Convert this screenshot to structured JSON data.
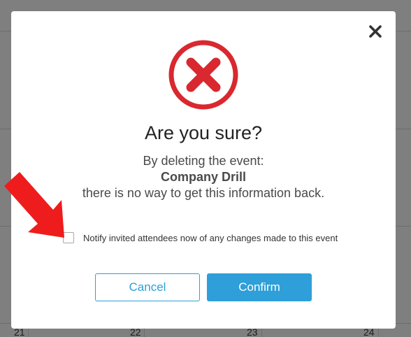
{
  "calendar": {
    "day_numbers": [
      "21",
      "22",
      "23",
      "24"
    ]
  },
  "dialog": {
    "title": "Are you sure?",
    "message_line1": "By deleting the event:",
    "event_name": "Company Drill",
    "message_line3": "there is no way to get this information back.",
    "notify_label": "Notify invited attendees now of any changes made to this event",
    "notify_checked": false,
    "cancel_label": "Cancel",
    "confirm_label": "Confirm"
  },
  "icons": {
    "close": "close-icon",
    "error": "error-circle-x-icon",
    "arrow": "red-pointer-arrow-icon"
  },
  "colors": {
    "accent": "#2e9fd8",
    "error_red": "#d9282f",
    "backdrop": "#808080"
  }
}
